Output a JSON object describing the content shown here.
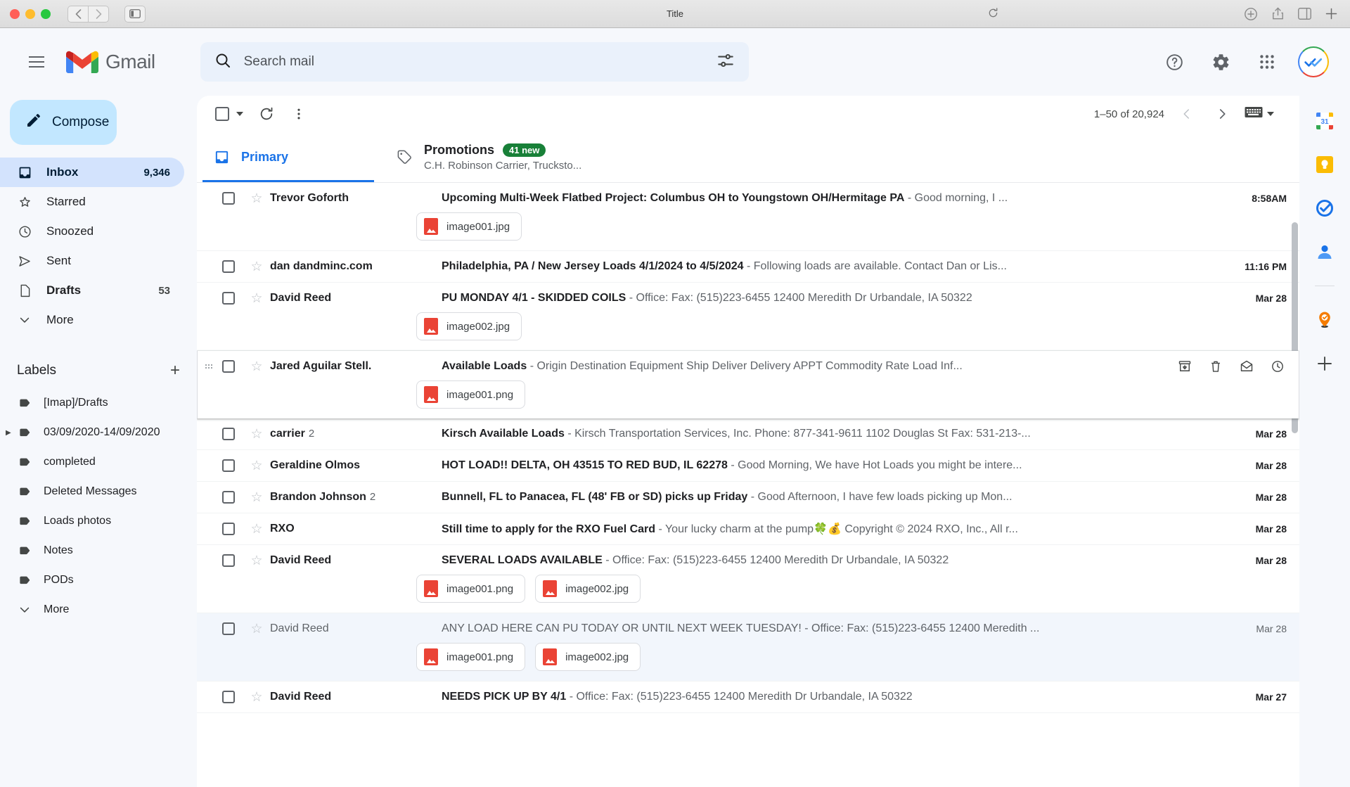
{
  "browser": {
    "title": "Title",
    "back_label": "‹",
    "forward_label": "›",
    "sidebar_toggle": "sidebar-toggle",
    "reload_label": "⟳"
  },
  "header": {
    "menu_label": "Main menu",
    "brand": "Gmail",
    "search": {
      "placeholder": "Search mail",
      "value": ""
    },
    "filter_label": "Show search options",
    "help_label": "Support",
    "settings_label": "Settings",
    "apps_label": "Google apps",
    "account_label": "Google Account"
  },
  "sidebar": {
    "compose_label": "Compose",
    "items": [
      {
        "label": "Inbox",
        "count": "9,346",
        "icon": "inbox-icon",
        "active": true,
        "bold": true
      },
      {
        "label": "Starred",
        "count": "",
        "icon": "star-icon",
        "active": false,
        "bold": false
      },
      {
        "label": "Snoozed",
        "count": "",
        "icon": "clock-icon",
        "active": false,
        "bold": false
      },
      {
        "label": "Sent",
        "count": "",
        "icon": "send-icon",
        "active": false,
        "bold": false
      },
      {
        "label": "Drafts",
        "count": "53",
        "icon": "draft-icon",
        "active": false,
        "bold": true
      },
      {
        "label": "More",
        "count": "",
        "icon": "chevron-down-icon",
        "active": false,
        "bold": false
      }
    ],
    "labels_title": "Labels",
    "labels_add_label": "+",
    "labels": [
      {
        "label": "[Imap]/Drafts",
        "expandable": false
      },
      {
        "label": "03/09/2020-14/09/2020",
        "expandable": true
      },
      {
        "label": "completed",
        "expandable": false
      },
      {
        "label": "Deleted Messages",
        "expandable": false
      },
      {
        "label": "Loads photos",
        "expandable": false
      },
      {
        "label": "Notes",
        "expandable": false
      },
      {
        "label": "PODs",
        "expandable": false
      }
    ],
    "labels_more": "More"
  },
  "toolbar": {
    "select_all_label": "Select",
    "refresh_label": "Refresh",
    "more_label": "More options",
    "pager_text": "1–50 of 20,924",
    "prev_label": "‹",
    "next_label": "›",
    "input_tools_label": "Select input tool"
  },
  "tabs": [
    {
      "label": "Primary",
      "icon": "inbox-icon",
      "active": true,
      "badge": "",
      "sub": ""
    },
    {
      "label": "Promotions",
      "icon": "tag-icon",
      "active": false,
      "badge": "41 new",
      "sub": "C.H. Robinson Carrier, Trucksto..."
    }
  ],
  "emails": [
    {
      "sender": "Trevor Goforth",
      "thread_count": "",
      "subject": "Upcoming Multi-Week Flatbed Project: Columbus OH to Youngstown OH/Hermitage PA",
      "snippet": "- Good morning, I ...",
      "date": "8:58AM",
      "read": false,
      "hover": false,
      "attachments": [
        "image001.jpg"
      ]
    },
    {
      "sender": "dan dandminc.com",
      "thread_count": "",
      "subject": "Philadelphia, PA / New Jersey Loads 4/1/2024 to 4/5/2024",
      "snippet": "- Following loads are available. Contact Dan or Lis...",
      "date": "11:16 PM",
      "read": false,
      "hover": false,
      "attachments": []
    },
    {
      "sender": "David Reed",
      "thread_count": "",
      "subject": "PU MONDAY 4/1 - SKIDDED COILS",
      "snippet": "- Office: Fax: (515)223-6455 12400 Meredith Dr Urbandale, IA 50322",
      "date": "Mar 28",
      "read": false,
      "hover": false,
      "attachments": [
        "image002.jpg"
      ]
    },
    {
      "sender": "Jared Aguilar Stell.",
      "thread_count": "",
      "subject": "Available Loads",
      "snippet": "- Origin Destination Equipment Ship Deliver Delivery APPT Commodity Rate Load Inf...",
      "date": "",
      "read": false,
      "hover": true,
      "attachments": [
        "image001.png"
      ],
      "actions": [
        "archive-icon",
        "trash-icon",
        "mark-unread-icon",
        "snooze-icon"
      ]
    },
    {
      "sender": "carrier",
      "thread_count": "2",
      "subject": "Kirsch Available Loads",
      "snippet": "- Kirsch Transportation Services, Inc. Phone: 877-341-9611 1102 Douglas St Fax: 531-213-...",
      "date": "Mar 28",
      "read": false,
      "hover": false,
      "attachments": []
    },
    {
      "sender": "Geraldine Olmos",
      "thread_count": "",
      "subject": "HOT LOAD!! DELTA, OH 43515 TO RED BUD, IL 62278",
      "snippet": "- Good Morning, We have Hot Loads you might be intere...",
      "date": "Mar 28",
      "read": false,
      "hover": false,
      "attachments": []
    },
    {
      "sender": "Brandon Johnson",
      "thread_count": "2",
      "subject": "Bunnell, FL to Panacea, FL (48' FB or SD) picks up Friday",
      "snippet": "- Good Afternoon, I have few loads picking up Mon...",
      "date": "Mar 28",
      "read": false,
      "hover": false,
      "attachments": []
    },
    {
      "sender": "RXO",
      "thread_count": "",
      "subject": "Still time to apply for the RXO Fuel Card",
      "snippet": "- Your lucky charm at the pump🍀💰 Copyright © 2024 RXO, Inc., All r...",
      "date": "Mar 28",
      "read": false,
      "hover": false,
      "attachments": []
    },
    {
      "sender": "David Reed",
      "thread_count": "",
      "subject": "SEVERAL LOADS AVAILABLE",
      "snippet": "- Office: Fax: (515)223-6455 12400 Meredith Dr Urbandale, IA 50322",
      "date": "Mar 28",
      "read": false,
      "hover": false,
      "attachments": [
        "image001.png",
        "image002.jpg"
      ]
    },
    {
      "sender": "David Reed",
      "thread_count": "",
      "subject": "ANY LOAD HERE CAN PU TODAY OR UNTIL NEXT WEEK TUESDAY!",
      "snippet": "- Office: Fax: (515)223-6455 12400 Meredith ...",
      "date": "Mar 28",
      "read": true,
      "hover": false,
      "attachments": [
        "image001.png",
        "image002.jpg"
      ]
    },
    {
      "sender": "David Reed",
      "thread_count": "",
      "subject": "NEEDS PICK UP BY 4/1",
      "snippet": "- Office: Fax: (515)223-6455 12400 Meredith Dr Urbandale, IA 50322",
      "date": "Mar 27",
      "read": false,
      "hover": false,
      "attachments": []
    }
  ],
  "right_rail": [
    {
      "icon": "google-calendar-icon",
      "label": "Calendar",
      "badge": "31"
    },
    {
      "icon": "google-keep-icon",
      "label": "Keep",
      "badge": ""
    },
    {
      "icon": "google-tasks-icon",
      "label": "Tasks",
      "badge": ""
    },
    {
      "icon": "google-contacts-icon",
      "label": "Contacts",
      "badge": ""
    },
    {
      "icon": "divider",
      "label": "",
      "badge": ""
    },
    {
      "icon": "google-maps-icon",
      "label": "Maps",
      "badge": ""
    },
    {
      "icon": "add-icon",
      "label": "Get add-ons",
      "badge": ""
    }
  ],
  "colors": {
    "accent": "#1a73e8",
    "badge_green": "#188038",
    "compose_bg": "#c2e7ff",
    "active_nav_bg": "#d3e3fd",
    "app_bg": "#f6f8fc"
  }
}
